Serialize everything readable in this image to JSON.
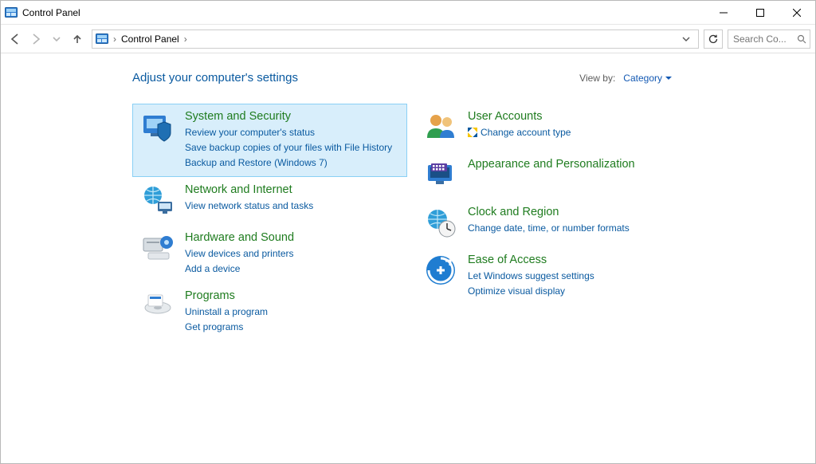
{
  "window": {
    "title": "Control Panel"
  },
  "addressbar": {
    "crumb1": "Control Panel"
  },
  "search": {
    "placeholder": "Search Co..."
  },
  "main": {
    "heading": "Adjust your computer's settings",
    "viewby_label": "View by:",
    "viewby_value": "Category"
  },
  "left": [
    {
      "title": "System and Security",
      "links": [
        "Review your computer's status",
        "Save backup copies of your files with File History",
        "Backup and Restore (Windows 7)"
      ]
    },
    {
      "title": "Network and Internet",
      "links": [
        "View network status and tasks"
      ]
    },
    {
      "title": "Hardware and Sound",
      "links": [
        "View devices and printers",
        "Add a device"
      ]
    },
    {
      "title": "Programs",
      "links": [
        "Uninstall a program",
        "Get programs"
      ]
    }
  ],
  "right": [
    {
      "title": "User Accounts",
      "links": [
        "Change account type"
      ],
      "shield": [
        true
      ]
    },
    {
      "title": "Appearance and Personalization",
      "links": []
    },
    {
      "title": "Clock and Region",
      "links": [
        "Change date, time, or number formats"
      ]
    },
    {
      "title": "Ease of Access",
      "links": [
        "Let Windows suggest settings",
        "Optimize visual display"
      ]
    }
  ]
}
